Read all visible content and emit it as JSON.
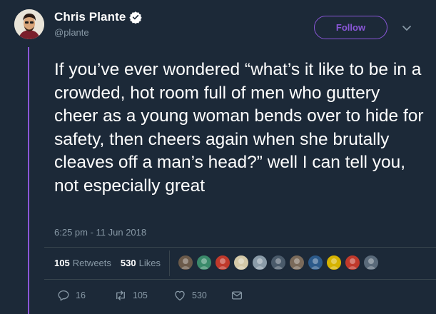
{
  "author": {
    "display_name": "Chris Plante",
    "handle": "@plante",
    "verified": true
  },
  "follow_label": "Follow",
  "tweet_text": "If you’ve ever wondered “what’s it like to be in a crowded, hot room full of men who guttery cheer as a young woman bends over to hide for safety, then cheers again when she brutally cleaves off a man’s head?” well I can tell you, not especially great",
  "timestamp": "6:25 pm - 11 Jun 2018",
  "stats": {
    "retweets_count": "105",
    "retweets_label": "Retweets",
    "likes_count": "530",
    "likes_label": "Likes"
  },
  "liker_avatar_colors": [
    "#6b5a4a",
    "#3a8a6a",
    "#c0392b",
    "#d4c9a8",
    "#8a9ba8",
    "#4a5a6a",
    "#7a6a5a",
    "#2c5a8a",
    "#d6b300",
    "#c0392b",
    "#5a6a7a"
  ],
  "actions": {
    "reply_count": "16",
    "retweet_count": "105",
    "like_count": "530"
  },
  "colors": {
    "background": "#1c2938",
    "accent": "#8a56d8",
    "muted": "#8899a6",
    "border": "#38444d"
  }
}
